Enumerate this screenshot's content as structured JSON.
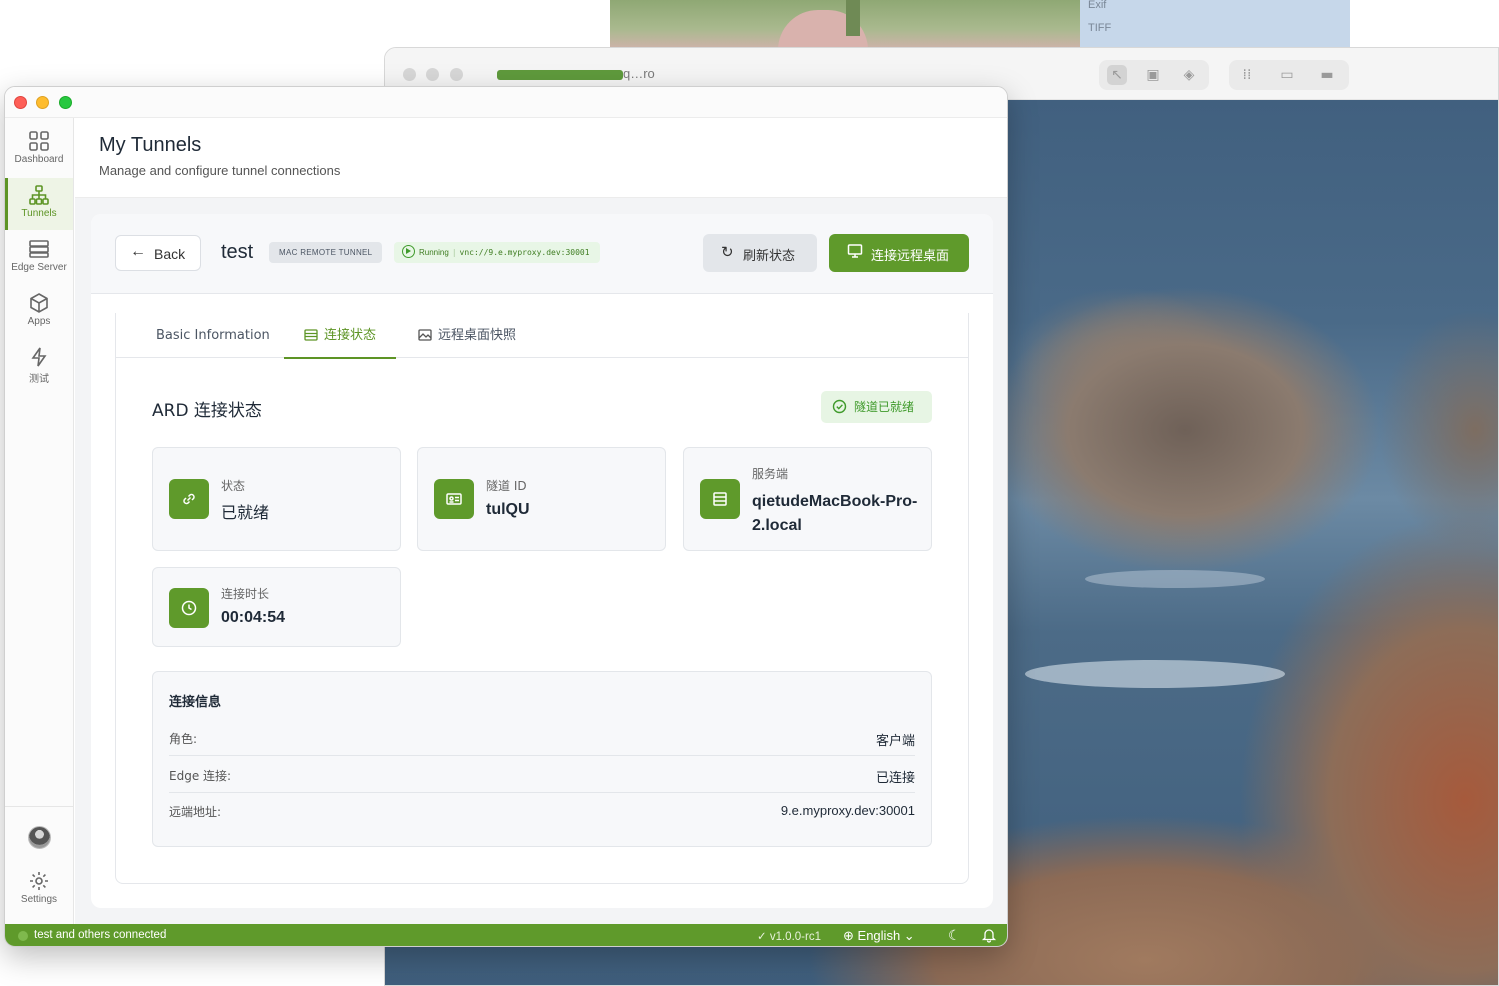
{
  "background": {
    "exif_items": [
      "Exif",
      "TIFF"
    ],
    "window_title": "q…ro"
  },
  "sidebar": {
    "items": [
      {
        "label": "Dashboard",
        "icon": "grid-icon",
        "active": false
      },
      {
        "label": "Tunnels",
        "icon": "network-icon",
        "active": true
      },
      {
        "label": "Edge Server",
        "icon": "server-icon",
        "active": false
      },
      {
        "label": "Apps",
        "icon": "box-icon",
        "active": false
      },
      {
        "label": "测试",
        "icon": "bolt-icon",
        "active": false
      }
    ],
    "settings_label": "Settings"
  },
  "header": {
    "title": "My Tunnels",
    "subtitle": "Manage and configure tunnel connections"
  },
  "detail": {
    "back_label": "Back",
    "tunnel_name": "test",
    "type_badge": "MAC REMOTE TUNNEL",
    "status": "Running",
    "status_sep": "|",
    "url": "vnc://9.e.myproxy.dev:30001",
    "refresh_label": "刷新状态",
    "connect_label": "连接远程桌面"
  },
  "tabs": [
    {
      "label": "Basic Information",
      "active": false
    },
    {
      "label": "连接状态",
      "active": true
    },
    {
      "label": "远程桌面快照",
      "active": false
    }
  ],
  "status_section": {
    "title": "ARD 连接状态",
    "badge": "隧道已就绪",
    "cards": [
      {
        "label": "状态",
        "value": "已就绪",
        "icon": "link-icon"
      },
      {
        "label": "隧道 ID",
        "value": "tulQU",
        "icon": "id-card-icon"
      },
      {
        "label": "服务端",
        "value": "qietudeMacBook-Pro-2.local",
        "icon": "server-icon"
      },
      {
        "label": "连接时长",
        "value": "00:04:54",
        "icon": "clock-icon"
      }
    ]
  },
  "connection_info": {
    "title": "连接信息",
    "rows": [
      {
        "key": "角色:",
        "value": "客户端"
      },
      {
        "key": "Edge 连接:",
        "value": "已连接"
      },
      {
        "key": "远端地址:",
        "value": "9.e.myproxy.dev:30001"
      }
    ]
  },
  "statusbar": {
    "connection_text": "test and others connected",
    "version": "v1.0.0-rc1",
    "language": "English"
  },
  "colors": {
    "accent": "#5f9a2b",
    "accent_light": "#e7f5e4"
  }
}
